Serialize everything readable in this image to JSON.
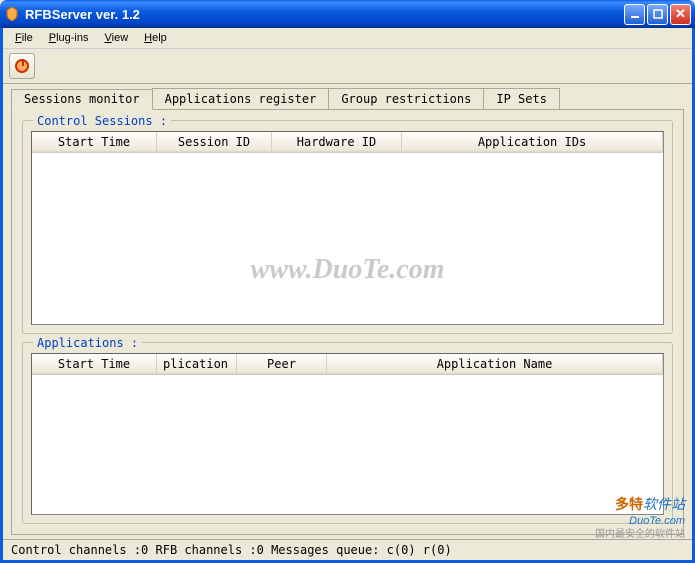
{
  "window": {
    "title": "RFBServer ver. 1.2"
  },
  "menubar": {
    "file": "File",
    "file_accel": "F",
    "plugins": "Plug-ins",
    "plugins_accel": "P",
    "view": "View",
    "view_accel": "V",
    "help": "Help",
    "help_accel": "H"
  },
  "tabs": {
    "sessions_monitor": "Sessions monitor",
    "applications_register": "Applications register",
    "group_restrictions": "Group restrictions",
    "ip_sets": "IP Sets"
  },
  "control_sessions": {
    "title": "Control Sessions :",
    "cols": {
      "start_time": "Start Time",
      "session_id": "Session ID",
      "hardware_id": "Hardware ID",
      "application_ids": "Application IDs"
    }
  },
  "applications": {
    "title": "Applications :",
    "cols": {
      "start_time": "Start Time",
      "application_id": "plication I",
      "peer": "Peer",
      "application_name": "Application Name"
    }
  },
  "statusbar": {
    "text": "Control channels :0  RFB channels :0  Messages queue: c(0) r(0)"
  },
  "watermark": "www.DuoTe.com",
  "branding": {
    "cn": "国内最安全的软件站",
    "name": "多特",
    "sub": "软件站",
    "url": "DuoTe.com"
  }
}
